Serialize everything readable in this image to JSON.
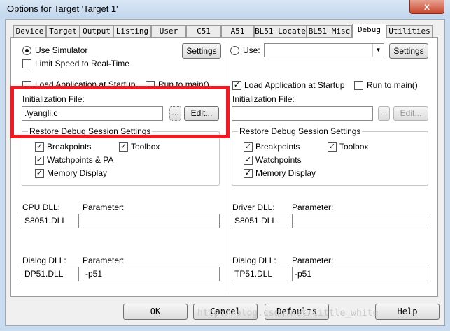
{
  "window": {
    "title": "Options for Target 'Target 1'",
    "close_glyph": "x"
  },
  "tabs": [
    {
      "label": "Device"
    },
    {
      "label": "Target"
    },
    {
      "label": "Output"
    },
    {
      "label": "Listing"
    },
    {
      "label": "User"
    },
    {
      "label": "C51"
    },
    {
      "label": "A51"
    },
    {
      "label": "BL51 Locate"
    },
    {
      "label": "BL51 Misc"
    },
    {
      "label": "Debug",
      "active": true
    },
    {
      "label": "Utilities"
    }
  ],
  "left": {
    "use_simulator_label": "Use Simulator",
    "settings_label": "Settings",
    "limit_speed_label": "Limit Speed to Real-Time",
    "load_app_label": "Load Application at Startup",
    "run_to_main_label": "Run to main()",
    "init_file_label": "Initialization File:",
    "init_file_value": ".\\yangli.c",
    "browse_label": "...",
    "edit_label": "Edit...",
    "restore_title": "Restore Debug Session Settings",
    "breakpoints_label": "Breakpoints",
    "toolbox_label": "Toolbox",
    "watchpoints_label": "Watchpoints & PA",
    "memory_label": "Memory Display",
    "cpu_dll_label": "CPU DLL:",
    "cpu_param_label": "Parameter:",
    "cpu_dll_value": "S8051.DLL",
    "cpu_param_value": "",
    "dialog_dll_label": "Dialog DLL:",
    "dialog_param_label": "Parameter:",
    "dialog_dll_value": "DP51.DLL",
    "dialog_param_value": "-p51"
  },
  "right": {
    "use_label": "Use:",
    "use_value": "",
    "settings_label": "Settings",
    "load_app_label": "Load Application at Startup",
    "run_to_main_label": "Run to main()",
    "init_file_label": "Initialization File:",
    "init_file_value": "",
    "browse_label": "...",
    "edit_label": "Edit...",
    "restore_title": "Restore Debug Session Settings",
    "breakpoints_label": "Breakpoints",
    "toolbox_label": "Toolbox",
    "watchpoints_label": "Watchpoints",
    "memory_label": "Memory Display",
    "driver_dll_label": "Driver DLL:",
    "driver_param_label": "Parameter:",
    "driver_dll_value": "S8051.DLL",
    "driver_param_value": "",
    "dialog_dll_label": "Dialog DLL:",
    "dialog_param_label": "Parameter:",
    "dialog_dll_value": "TP51.DLL",
    "dialog_param_value": "-p51"
  },
  "footer": {
    "ok_label": "OK",
    "cancel_label": "Cancel",
    "defaults_label": "Defaults",
    "help_label": "Help"
  },
  "watermark": "http://blog.csdn.net/little_white",
  "colors": {
    "highlight": "#ec1c24",
    "titlebar": "#c9dcef"
  }
}
